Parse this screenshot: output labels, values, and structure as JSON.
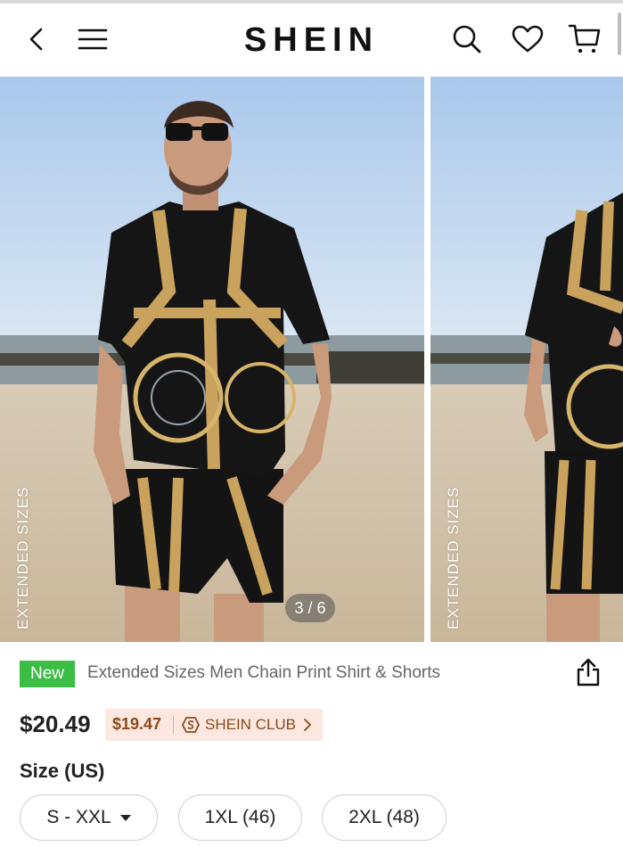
{
  "header": {
    "logo": "SHEIN",
    "icons": [
      "back-icon",
      "menu-icon",
      "search-icon",
      "heart-icon",
      "cart-icon"
    ]
  },
  "gallery": {
    "slide_label": "EXTENDED SIZES",
    "counter": "3 / 6"
  },
  "product": {
    "badge": "New",
    "title": "Extended Sizes Men Chain Print Shirt & Shorts",
    "price": "$20.49",
    "club_price": "$19.47",
    "club_label": "SHEIN CLUB",
    "size_heading": "Size (US)",
    "sizes": [
      "S - XXL",
      "1XL (46)",
      "2XL (48)"
    ]
  },
  "colors": {
    "new_badge": "#3cbd45",
    "club_bg": "#fde8e1",
    "club_text": "#8a4a1a"
  }
}
